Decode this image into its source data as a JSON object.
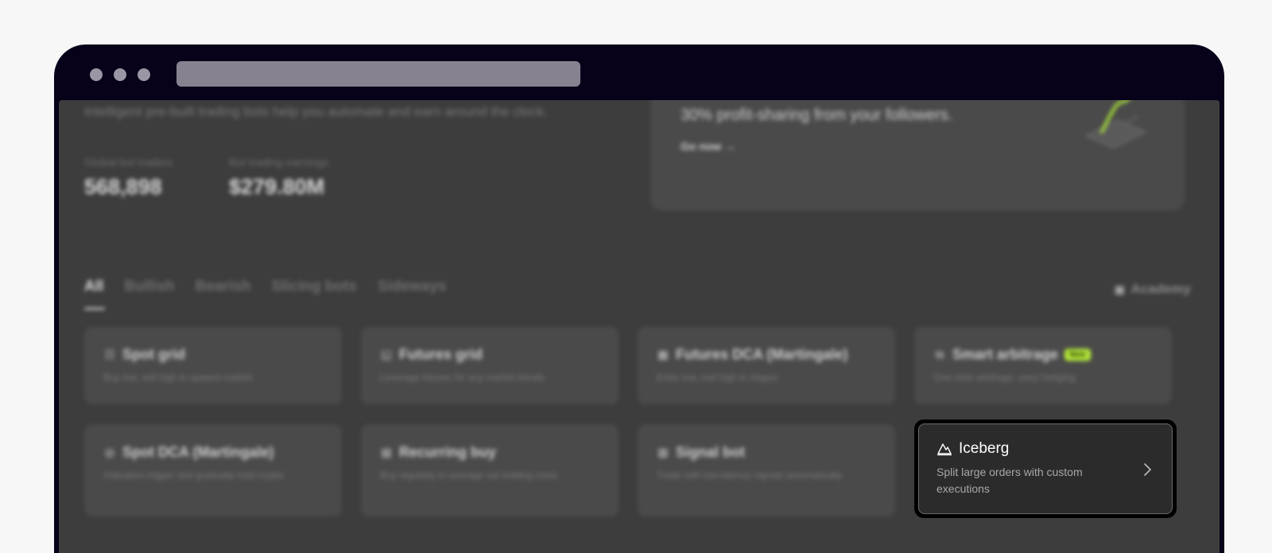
{
  "intro": "Intelligent pre-built trading bots help you automate and earn around the clock.",
  "stats": [
    {
      "label": "Global bot traders",
      "value": "568,898"
    },
    {
      "label": "Bot trading earnings",
      "value": "$279.80M"
    }
  ],
  "promo": {
    "text": "30% profit-sharing from your followers.",
    "link": "Go now →"
  },
  "tabs": [
    "All",
    "Bullish",
    "Bearish",
    "Slicing bots",
    "Sideways"
  ],
  "academy": "Academy",
  "cards": [
    {
      "title": "Spot grid",
      "desc": "Buy low, sell high in upward market",
      "icon": "grid-icon"
    },
    {
      "title": "Futures grid",
      "desc": "Leverage futures for any market trends",
      "icon": "futures-icon"
    },
    {
      "title": "Futures DCA (Martingale)",
      "desc": "Enter low, exit high in stages",
      "icon": "dca-icon"
    },
    {
      "title": "Smart arbitrage",
      "desc": "One-click arbitrage, easy hedging",
      "icon": "arbitrage-icon",
      "badge": "New"
    },
    {
      "title": "Spot DCA (Martingale)",
      "desc": "Indicators trigger and gradually hold crypto",
      "icon": "target-icon"
    },
    {
      "title": "Recurring buy",
      "desc": "Buy regularly to average out holding costs",
      "icon": "calendar-icon"
    },
    {
      "title": "Signal bot",
      "desc": "Trade with low-latency signals automatically",
      "icon": "signal-icon"
    }
  ],
  "focused": {
    "title": "Iceberg",
    "desc": "Split large orders with custom executions",
    "icon": "iceberg-icon"
  },
  "colors": {
    "accent": "#b8f03a",
    "background": "#3d3d3d",
    "frame": "#07021a"
  }
}
